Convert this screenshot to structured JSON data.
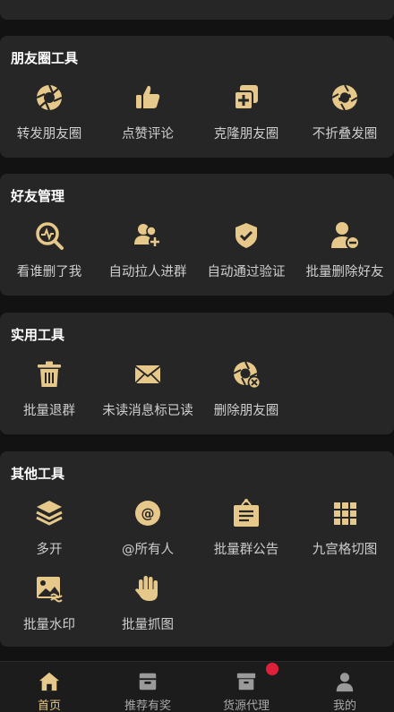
{
  "sections": [
    {
      "title": "朋友圈工具",
      "items": [
        {
          "label": "转发朋友圈",
          "icon": "aperture-icon"
        },
        {
          "label": "点赞评论",
          "icon": "thumbs-up-icon"
        },
        {
          "label": "克隆朋友圈",
          "icon": "clone-plus-icon"
        },
        {
          "label": "不折叠发圈",
          "icon": "aperture-refresh-icon"
        }
      ]
    },
    {
      "title": "好友管理",
      "items": [
        {
          "label": "看谁删了我",
          "icon": "magnifier-pulse-icon"
        },
        {
          "label": "自动拉人进群",
          "icon": "group-add-icon"
        },
        {
          "label": "自动通过验证",
          "icon": "shield-check-icon"
        },
        {
          "label": "批量删除好友",
          "icon": "user-remove-icon"
        }
      ]
    },
    {
      "title": "实用工具",
      "items": [
        {
          "label": "批量退群",
          "icon": "trash-icon"
        },
        {
          "label": "未读消息标已读",
          "icon": "envelope-icon"
        },
        {
          "label": "删除朋友圈",
          "icon": "aperture-delete-icon"
        }
      ]
    },
    {
      "title": "其他工具",
      "items": [
        {
          "label": "多开",
          "icon": "layers-icon"
        },
        {
          "label": "@所有人",
          "icon": "at-sign-icon"
        },
        {
          "label": "批量群公告",
          "icon": "notice-board-icon"
        },
        {
          "label": "九宫格切图",
          "icon": "grid-nine-icon"
        },
        {
          "label": "批量水印",
          "icon": "image-watermark-icon"
        },
        {
          "label": "批量抓图",
          "icon": "hand-grab-icon"
        }
      ]
    }
  ],
  "tabbar": [
    {
      "label": "首页",
      "icon": "home-icon",
      "active": true
    },
    {
      "label": "推荐有奖",
      "icon": "gift-box-icon"
    },
    {
      "label": "货源代理",
      "icon": "archive-box-icon",
      "badge": true
    },
    {
      "label": "我的",
      "icon": "user-icon"
    }
  ],
  "colors": {
    "accent": "#e6c98a",
    "card": "#262626",
    "background": "#121212",
    "badge": "#e0203a"
  }
}
